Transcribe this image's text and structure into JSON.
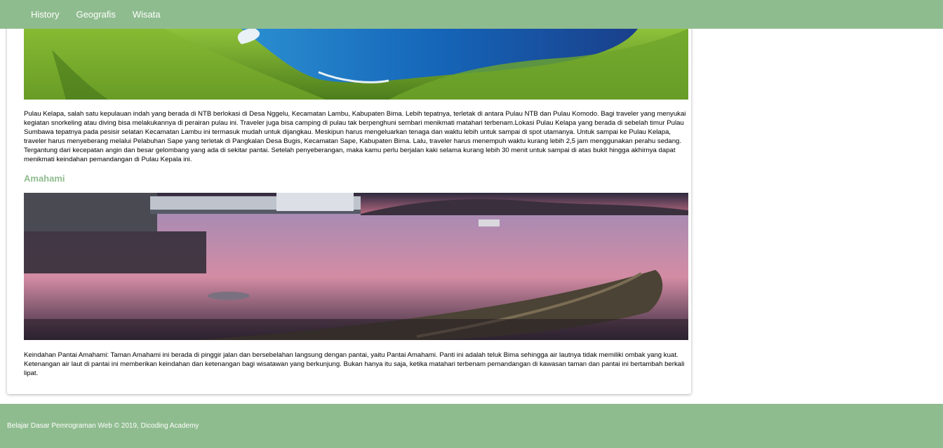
{
  "nav": {
    "items": [
      {
        "label": "History"
      },
      {
        "label": "Geografis"
      },
      {
        "label": "Wisata"
      }
    ]
  },
  "content": {
    "pulau_kelapa_text": "Pulau Kelapa, salah satu kepulauan indah yang berada di NTB berlokasi di Desa Nggelu, Kecamatan Lambu, Kabupaten Bima. Lebih tepatnya, terletak di antara Pulau NTB dan Pulau Komodo. Bagi traveler yang menyukai kegiatan snorkeling atau diving bisa melakukannya di perairan pulau ini. Traveler juga bisa camping di pulau tak berpenghuni sembari menikmati matahari terbenam.Lokasi Pulau Kelapa yang berada di sebelah timur Pulau Sumbawa tepatnya pada pesisir selatan Kecamatan Lambu ini termasuk mudah untuk dijangkau. Meskipun harus mengeluarkan tenaga dan waktu lebih untuk sampai di spot utamanya. Untuk sampai ke Pulau Kelapa, traveler harus menyeberang melalui Pelabuhan Sape yang terletak di Pangkalan Desa Bugis, Kecamatan Sape, Kabupaten Bima. Lalu, traveler harus menempuh waktu kurang lebih 2,5 jam menggunakan perahu sedang. Tergantung dari kecepatan angin dan besar gelombang yang ada di sekitar pantai. Setelah penyeberangan, maka kamu perlu berjalan kaki selama kurang lebih 30 menit untuk sampai di atas bukit hingga akhirnya dapat menikmati keindahan pemandangan di Pulau Kepala ini.",
    "amahami_title": "Amahami",
    "amahami_text": "Keindahan Pantai Amahami: Taman Amahami ini berada di pinggir jalan dan bersebelahan langsung dengan pantai, yaitu Pantai Amahami. Panti ini adalah teluk Bima sehingga air lautnya tidak memiliki ombak yang kuat. Ketenangan air laut di pantai ini memberikan keindahan dan ketenangan bagi wisatawan yang berkunjung. Bukan hanya itu saja, ketika matahari terbenam pemandangan di kawasan taman dan pantai ini bertambah berkali lipat."
  },
  "footer": {
    "text": "Belajar Dasar Pemrograman Web © 2019, Dicoding Academy"
  },
  "colors": {
    "nav_bg": "#8fbc8f",
    "accent": "#8fbc8f"
  }
}
